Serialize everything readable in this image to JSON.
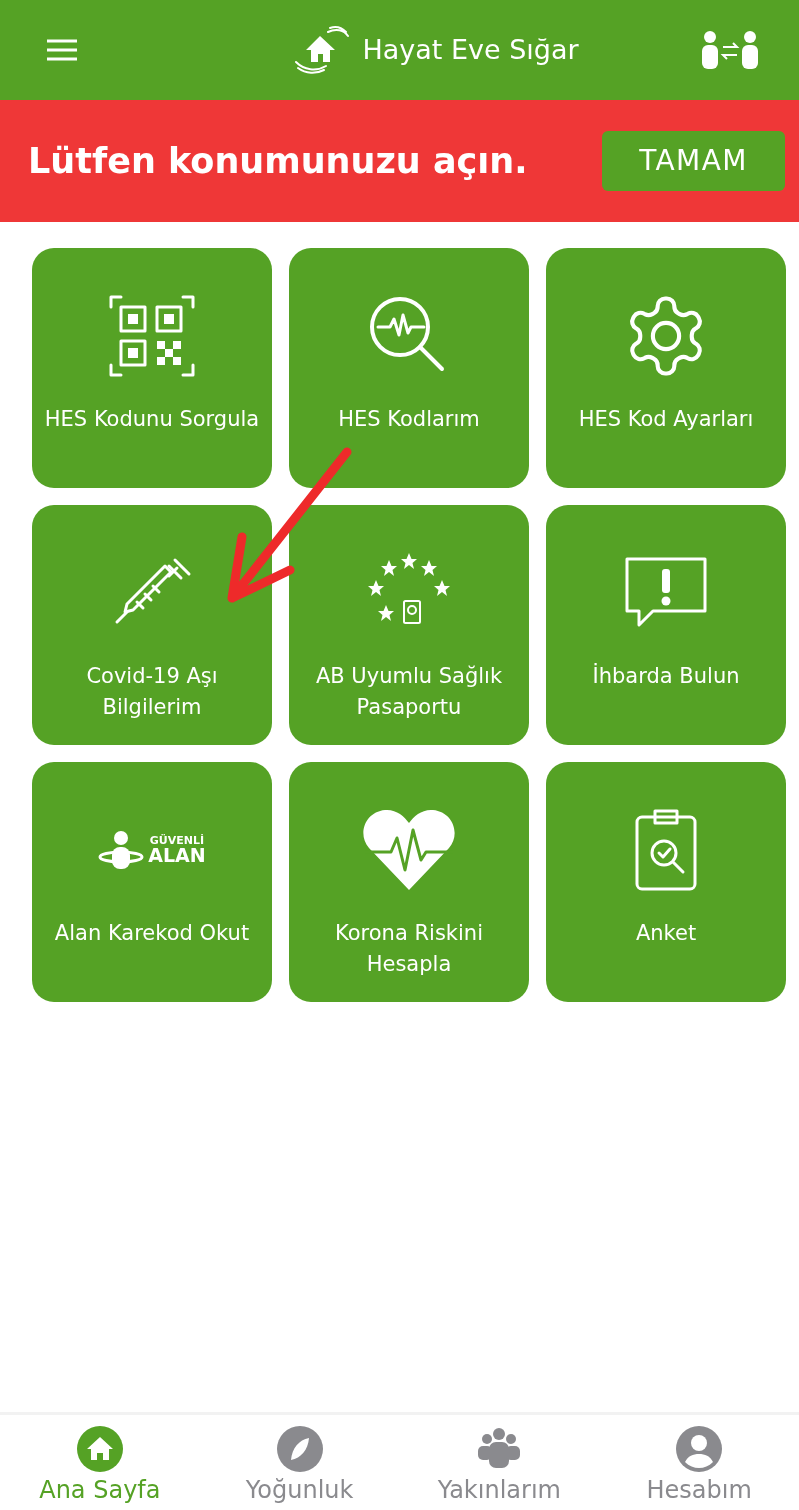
{
  "app_bar": {
    "title": "Hayat Eve Sığar"
  },
  "banner": {
    "message": "Lütfen konumunuzu açın.",
    "button": "TAMAM"
  },
  "tiles": [
    {
      "kind": "qr",
      "label": "HES Kodunu Sorgula"
    },
    {
      "kind": "search",
      "label": "HES Kodlarım"
    },
    {
      "kind": "gear",
      "label": "HES Kod Ayarları"
    },
    {
      "kind": "syringe",
      "label": "Covid-19 Aşı Bilgilerim"
    },
    {
      "kind": "passport",
      "label": "AB Uyumlu Sağlık Pasaportu"
    },
    {
      "kind": "alert",
      "label": "İhbarda Bulun"
    },
    {
      "kind": "logo",
      "label": "Alan Karekod Okut",
      "logo_top": "GÜVENLİ",
      "logo_bottom": "ALAN"
    },
    {
      "kind": "heart",
      "label": "Korona Riskini Hesapla"
    },
    {
      "kind": "survey",
      "label": "Anket"
    }
  ],
  "annotation": {
    "kind": "arrow"
  },
  "bottom_nav": [
    {
      "kind": "home",
      "label": "Ana Sayfa",
      "selected": true
    },
    {
      "kind": "compass",
      "label": "Yoğunluk",
      "selected": false
    },
    {
      "kind": "people",
      "label": "Yakınlarım",
      "selected": false
    },
    {
      "kind": "account",
      "label": "Hesabım",
      "selected": false
    }
  ]
}
